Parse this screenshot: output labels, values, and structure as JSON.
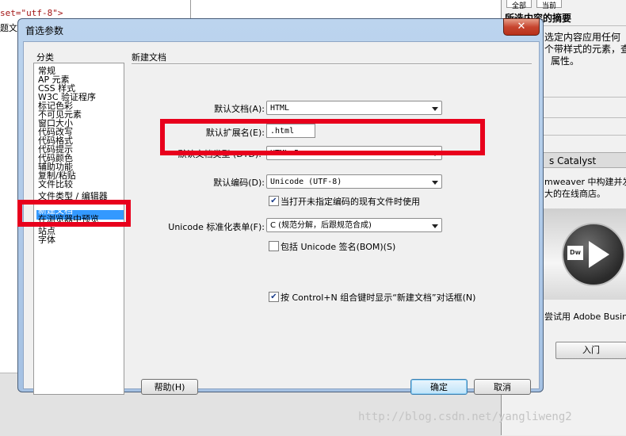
{
  "background": {
    "code_lines": [
      "set=\"utf-8\">",
      "题文"
    ],
    "right_panel": {
      "tabs": [
        "全部",
        "当前"
      ],
      "summary_title": "所选内容的摘要",
      "summary_lines": [
        "选定内容应用任何",
        "个带样式的元素，查",
        "属性。"
      ],
      "catalyst_title": "s Catalyst",
      "catalyst_lines": [
        "mweaver 中构建并发",
        "大的在线商店。"
      ],
      "logo_text": "Dw",
      "try_text": "尝试用 Adobe Busine",
      "entry_button": "入门"
    },
    "watermark": "http://blog.csdn.net/yangliweng2"
  },
  "dialog": {
    "title": "首选参数",
    "close_label": "✕",
    "category_label": "分类",
    "categories": [
      "常规",
      "AP 元素",
      "CSS 样式",
      "W3C 验证程序",
      "标记色彩",
      "不可见元素",
      "窗口大小",
      "代码改写",
      "代码格式",
      "代码提示",
      "代码颜色",
      "辅助功能",
      "复制/粘贴",
      "文件比较",
      "文件类型 / 编辑器",
      "新建文档",
      "在浏览器中预览",
      "站点",
      "字体"
    ],
    "selected_category": "新建文档",
    "section_title": "新建文档",
    "fields": {
      "default_doc_label": "默认文档(A):",
      "default_doc_value": "HTML",
      "default_ext_label": "默认扩展名(E):",
      "default_ext_value": ".html",
      "dtd_label": "默认文档类型 (DTD):",
      "dtd_value": "HTML 5",
      "encoding_label": "默认编码(D):",
      "encoding_value": "Unicode (UTF-8)",
      "use_when_open_label": "当打开未指定编码的现有文件时使用",
      "normalize_label": "Unicode 标准化表单(F):",
      "normalize_value": "C (规范分解，后跟规范合成)",
      "include_sig_label": "包括 Unicode 签名(BOM)(S)",
      "show_dialog_label": "按 Control+N 组合键时显示“新建文档”对话框(N)"
    },
    "checkboxes": {
      "use_when_open": true,
      "include_sig": false,
      "show_dialog": true
    },
    "buttons": {
      "help": "帮助(H)",
      "ok": "确定",
      "cancel": "取消"
    },
    "highlight_color": "#e8001c"
  }
}
